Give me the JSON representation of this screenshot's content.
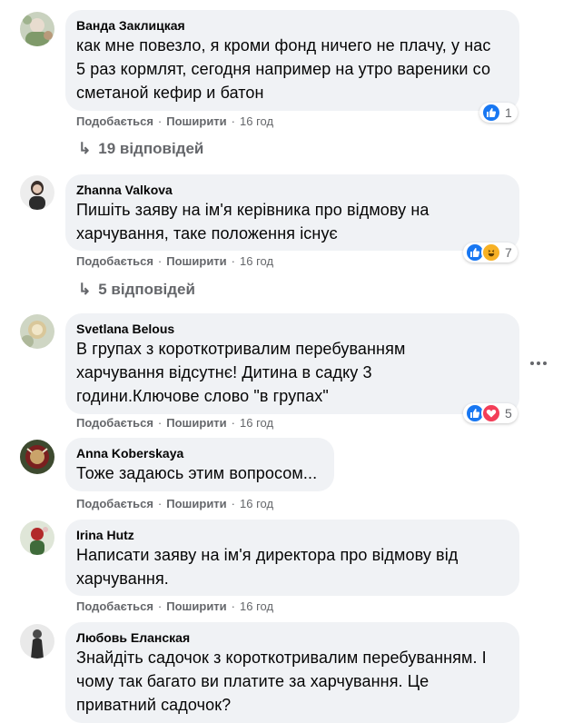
{
  "comments": [
    {
      "author": "Ванда Заклицкая",
      "text": "как мне повезло, я кроми фонд ничего не плачу, у нас\n5 раз кормлят, сегодня например на утро вареники со\nсметаной кефир и батон",
      "like_label": "Подобається",
      "share_label": "Поширити",
      "time": "16 год",
      "reaction_count": "1",
      "replies_label": "19 відповідей"
    },
    {
      "author": "Zhanna Valkova",
      "text": "Пишіть заяву на ім'я керівника про відмову на\nхарчування, таке положення існує",
      "like_label": "Подобається",
      "share_label": "Поширити",
      "time": "16 год",
      "reaction_count": "7",
      "replies_label": "5 відповідей"
    },
    {
      "author": "Svetlana Belous",
      "text": "В групах з короткотривалим перебуванням\nхарчування відсутнє! Дитина в садку 3\nгодини.Ключове слово \"в групах\"",
      "like_label": "Подобається",
      "share_label": "Поширити",
      "time": "16 год",
      "reaction_count": "5"
    },
    {
      "author": "Anna Koberskaya",
      "text": "Тоже задаюсь этим вопросом...",
      "like_label": "Подобається",
      "share_label": "Поширити",
      "time": "16 год"
    },
    {
      "author": "Irina Hutz",
      "text": "Написати заяву на ім'я директора про відмову від\nхарчування.",
      "like_label": "Подобається",
      "share_label": "Поширити",
      "time": "16 год"
    },
    {
      "author": "Любовь Еланская",
      "text": "Знайдіть садочок з короткотривалим перебуванням. І\nчому так багато ви платите за харчування. Це\nприватний садочок?"
    }
  ],
  "icons": {
    "like": "like-reaction-icon",
    "haha": "haha-reaction-icon",
    "love": "love-reaction-icon",
    "reply_arrow": "reply-arrow-icon",
    "more": "more-options-icon"
  },
  "colors": {
    "bubble": "#f0f2f5",
    "meta_text": "#65676b",
    "like_blue": "#1877f2",
    "love_red": "#f33e58",
    "haha_yellow": "#f7b125"
  }
}
